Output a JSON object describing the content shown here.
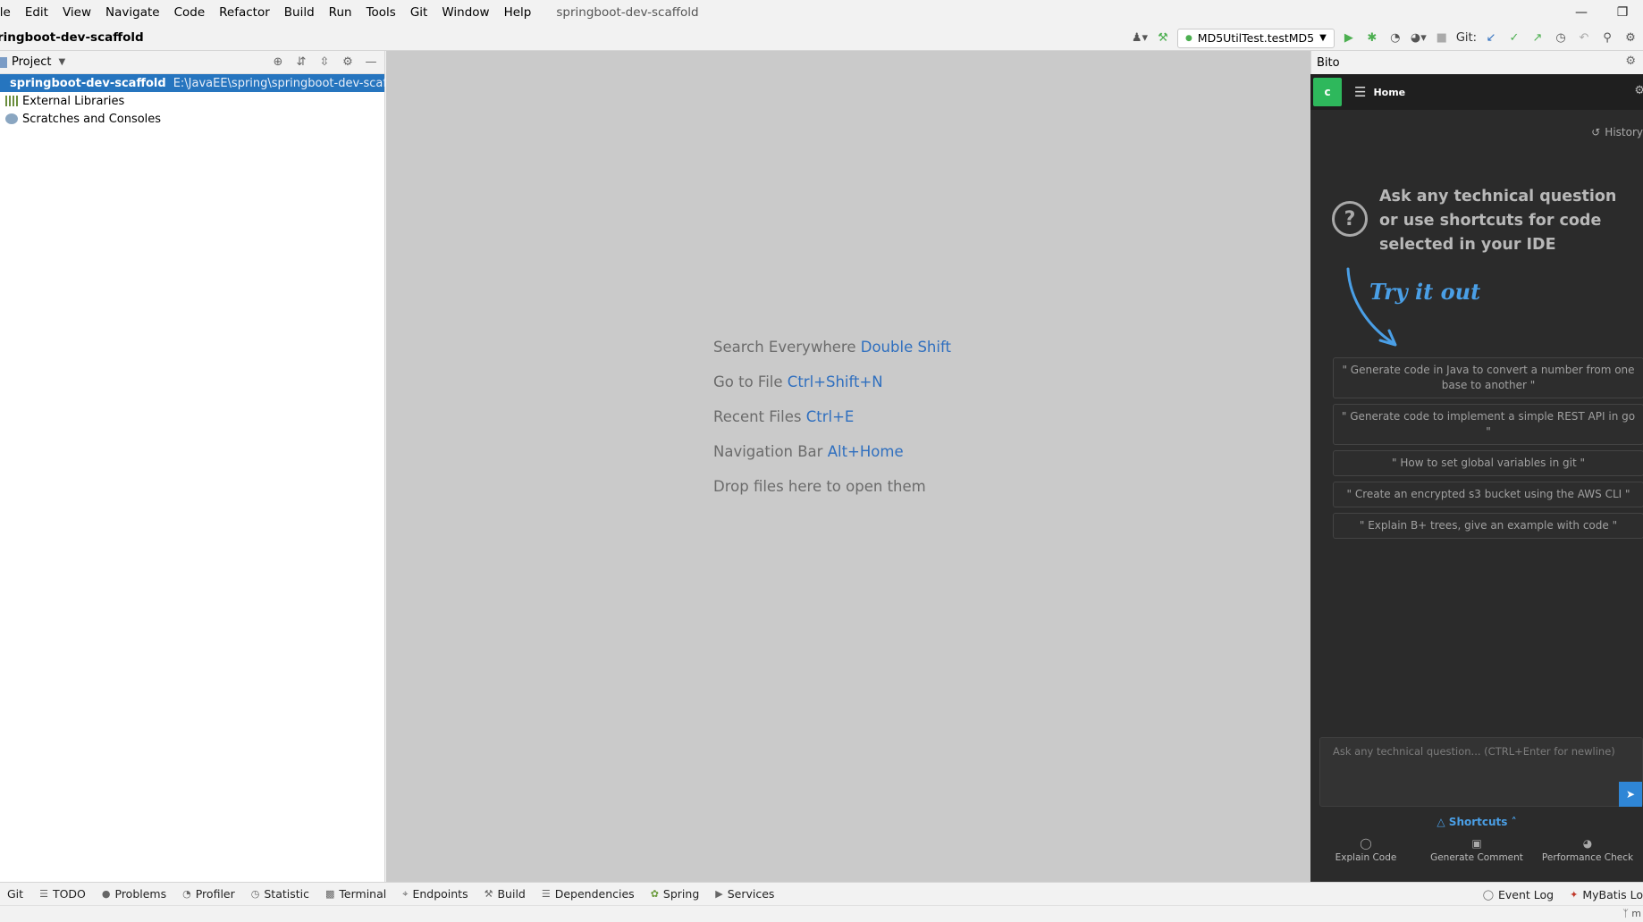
{
  "menu": {
    "items": [
      "ile",
      "Edit",
      "View",
      "Navigate",
      "Code",
      "Refactor",
      "Build",
      "Run",
      "Tools",
      "Git",
      "Window",
      "Help"
    ],
    "window_title": "springboot-dev-scaffold"
  },
  "navbar": {
    "breadcrumb": "ringboot-dev-scaffold",
    "run_config": "MD5UtilTest.testMD5",
    "git_label": "Git:"
  },
  "project": {
    "title": "Project",
    "tree": [
      {
        "label": "springboot-dev-scaffold",
        "path": "E:\\JavaEE\\spring\\springboot-dev-scaffold"
      },
      {
        "label": "External Libraries"
      },
      {
        "label": "Scratches and Consoles"
      }
    ]
  },
  "editor": {
    "hints": [
      {
        "text": "Search Everywhere",
        "key": "Double Shift"
      },
      {
        "text": "Go to File",
        "key": "Ctrl+Shift+N"
      },
      {
        "text": "Recent Files",
        "key": "Ctrl+E"
      },
      {
        "text": "Navigation Bar",
        "key": "Alt+Home"
      },
      {
        "text": "Drop files here to open them",
        "key": ""
      }
    ]
  },
  "bito": {
    "panel_title": "Bito",
    "avatar_letter": "c",
    "home_label": "Home",
    "history_label": "History",
    "intro": "Ask any technical question or use shortcuts for code selected in your IDE",
    "try_it": "Try it out",
    "prompts": [
      "\" Generate code in Java to convert a number from one base to another \"",
      "\" Generate code to implement a simple REST API in go \"",
      "\" How to set global variables in git \"",
      "\" Create an encrypted s3 bucket using the AWS CLI \"",
      "\" Explain B+ trees, give an example with code \""
    ],
    "input_placeholder": "Ask any technical question... (CTRL+Enter for newline)",
    "shortcuts_label": "Shortcuts",
    "actions": [
      "Explain Code",
      "Generate Comment",
      "Performance Check"
    ]
  },
  "statusbar": {
    "left": [
      "Git",
      "TODO",
      "Problems",
      "Profiler",
      "Statistic",
      "Terminal",
      "Endpoints",
      "Build",
      "Dependencies",
      "Spring",
      "Services"
    ],
    "right": [
      "Event Log",
      "MyBatis Lo"
    ]
  },
  "colors": {
    "selection": "#2675bf",
    "editor_bg": "#cacaca",
    "bito_bg": "#2b2b2b",
    "accent_blue": "#4a9fe6",
    "avatar_green": "#2eb85c"
  }
}
